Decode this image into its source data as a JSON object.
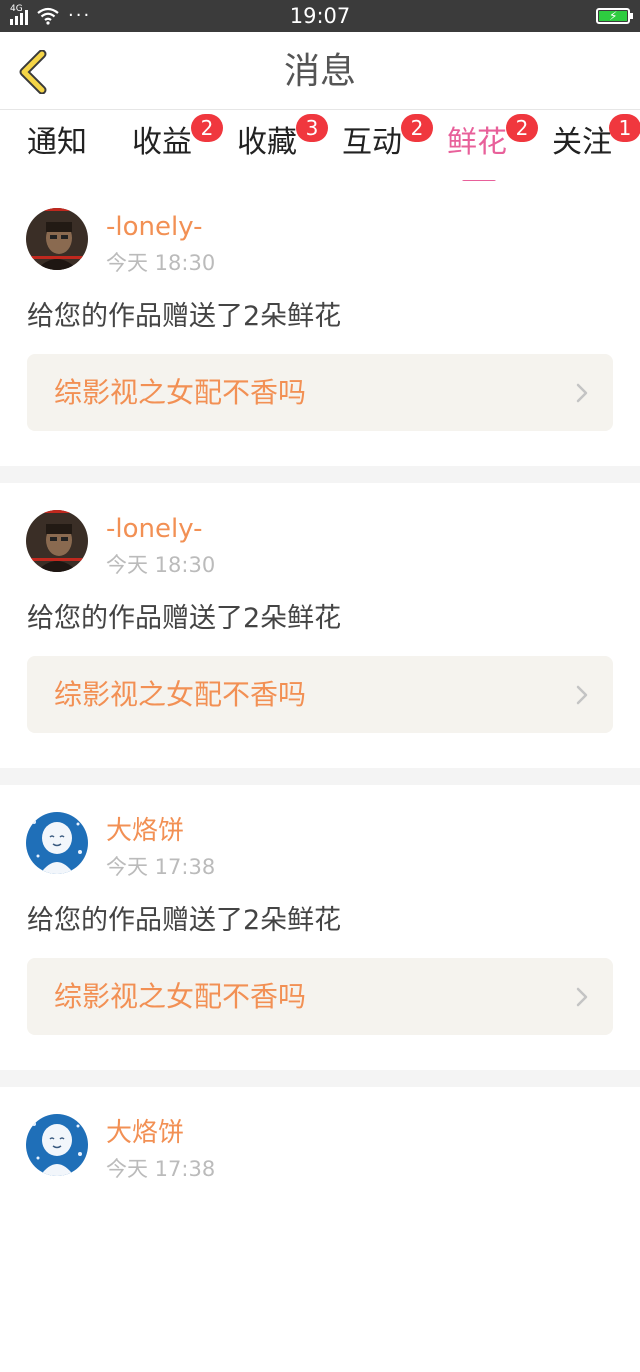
{
  "status_bar": {
    "network": "4G",
    "time": "19:07",
    "more": "···"
  },
  "header": {
    "title": "消息"
  },
  "tabs": [
    {
      "label": "通知",
      "badge": ""
    },
    {
      "label": "收益",
      "badge": "2"
    },
    {
      "label": "收藏",
      "badge": "3"
    },
    {
      "label": "互动",
      "badge": "2"
    },
    {
      "label": "鲜花",
      "badge": "2"
    },
    {
      "label": "关注",
      "badge": "1"
    }
  ],
  "active_tab": "鲜花",
  "messages": [
    {
      "user": "-lonely-",
      "time": "今天 18:30",
      "text": "给您的作品赠送了2朵鲜花",
      "work": "综影视之女配不香吗"
    },
    {
      "user": "-lonely-",
      "time": "今天 18:30",
      "text": "给您的作品赠送了2朵鲜花",
      "work": "综影视之女配不香吗"
    },
    {
      "user": "大烙饼",
      "time": "今天 17:38",
      "text": "给您的作品赠送了2朵鲜花",
      "work": "综影视之女配不香吗"
    },
    {
      "user": "大烙饼",
      "time": "今天 17:38",
      "text": "",
      "work": ""
    }
  ],
  "colors": {
    "accent_pink": "#e8609a",
    "name_orange": "#f29054",
    "badge_red": "#f0373e",
    "back_arrow_yellow": "#f5d547"
  },
  "icons": {
    "back": "chevron-left-icon",
    "work_link": "chevron-right-icon",
    "battery": "battery-charging-icon",
    "wifi": "wifi-icon",
    "signal": "signal-icon"
  }
}
